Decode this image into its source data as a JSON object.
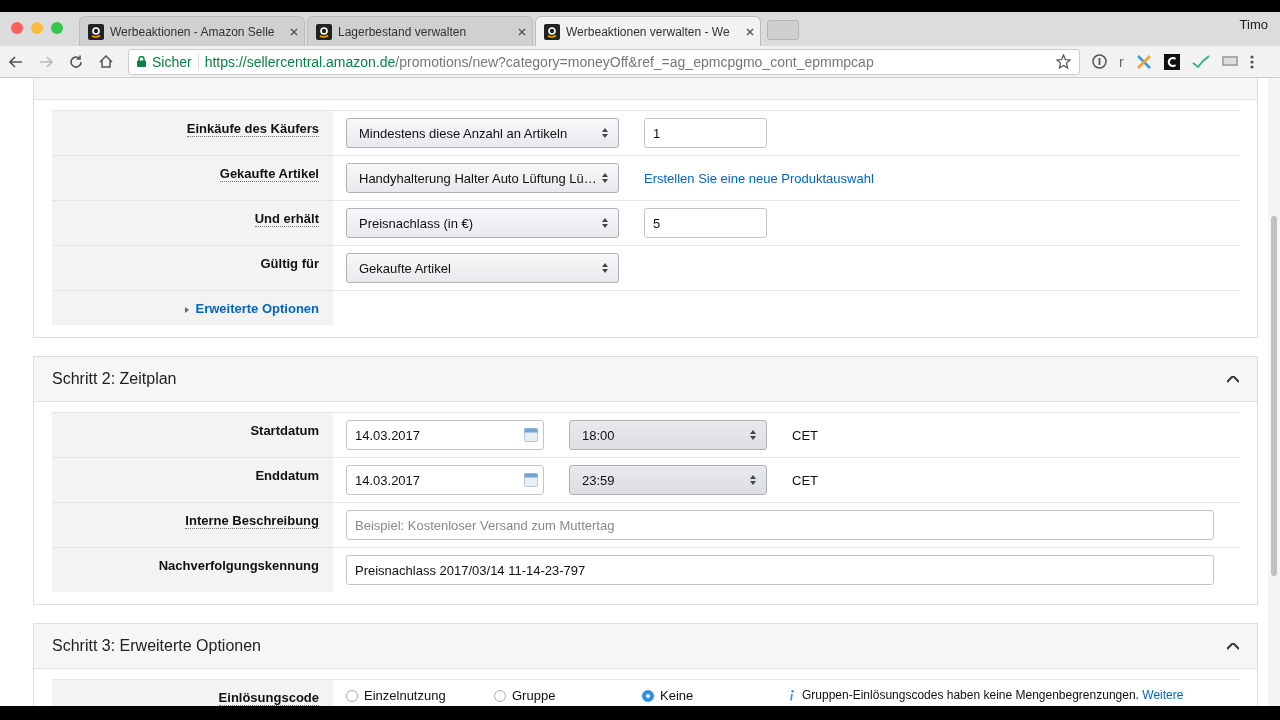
{
  "browser": {
    "tabs": [
      {
        "title": "Werbeaktionen - Amazon Selle",
        "selected": false
      },
      {
        "title": "Lagerbestand verwalten",
        "selected": false
      },
      {
        "title": "Werbeaktionen verwalten - We",
        "selected": true
      }
    ],
    "profile": "Timo",
    "secure_label": "Sicher",
    "url_host": "https://sellercentral.amazon.de",
    "url_path": "/promotions/new?category=moneyOff&ref_=ag_epmcpgmo_cont_epmmpcap",
    "extension_letter": "r"
  },
  "step1": {
    "rows": [
      {
        "kind": "select-input",
        "label": "Einkäufe des Käufers",
        "help": true,
        "select": "Mindestens diese Anzahl an Artikeln",
        "value": "1"
      },
      {
        "kind": "select-link",
        "label": "Gekaufte Artikel",
        "help": true,
        "select": "Handyhalterung Halter Auto Lüftung Lü…",
        "link": "Erstellen Sie eine neue Produktauswahl"
      },
      {
        "kind": "select-input",
        "label": "Und erhält",
        "help": true,
        "select": "Preisnachlass (in €)",
        "value": "5"
      },
      {
        "kind": "select",
        "label": "Gültig für",
        "help": false,
        "select": "Gekaufte Artikel"
      },
      {
        "kind": "toggle",
        "label": "Erweiterte Optionen",
        "help": false
      }
    ]
  },
  "step2": {
    "title": "Schritt 2: Zeitplan",
    "expanded": true,
    "rows": [
      {
        "kind": "datetime",
        "label": "Startdatum",
        "help": false,
        "date": "14.03.2017",
        "time": "18:00",
        "zone": "CET"
      },
      {
        "kind": "datetime",
        "label": "Enddatum",
        "help": false,
        "date": "14.03.2017",
        "time": "23:59",
        "zone": "CET"
      },
      {
        "kind": "text",
        "label": "Interne Beschreibung",
        "help": true,
        "placeholder": "Beispiel: Kostenloser Versand zum Muttertag"
      },
      {
        "kind": "text",
        "label": "Nachverfolgungskennung",
        "help": false,
        "value": "Preisnachlass 2017/03/14 11-14-23-797"
      }
    ]
  },
  "step3": {
    "title": "Schritt 3: Erweiterte Optionen",
    "expanded": true,
    "rows": [
      {
        "kind": "radio",
        "label": "Einlösungscode",
        "help": true,
        "options": [
          {
            "label": "Einzelnutzung",
            "selected": false
          },
          {
            "label": "Gruppe",
            "selected": false
          },
          {
            "label": "Keine",
            "selected": true
          }
        ],
        "info": "Gruppen-Einlösungscodes haben keine Mengenbegrenzungen.",
        "info_link": "Weitere"
      }
    ]
  }
}
